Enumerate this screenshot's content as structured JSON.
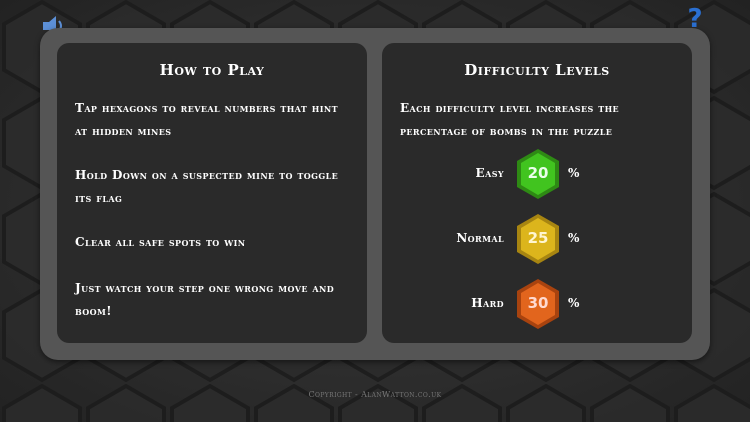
{
  "how_to_play": {
    "title": "How to Play",
    "lines": [
      "Tap hexagons to reveal numbers that hint at hidden mines",
      "Hold Down on a suspected mine to toggle its flag",
      "Clear all safe spots to win",
      "Just watch your step one wrong move and boom!"
    ]
  },
  "difficulty": {
    "title": "Difficulty Levels",
    "description": "Each difficulty level increases the percentage of bombs in the puzzle",
    "levels": [
      {
        "label": "Easy",
        "value": "20",
        "unit": "%",
        "color": "#3fbf1e",
        "text_color": "#eaffea"
      },
      {
        "label": "Normal",
        "value": "25",
        "unit": "%",
        "color": "#d9b41a",
        "text_color": "#fff6d0"
      },
      {
        "label": "Hard",
        "value": "30",
        "unit": "%",
        "color": "#e0631c",
        "text_color": "#ffd9d0"
      }
    ]
  },
  "footer": {
    "copyright": "Copyright - AlanWatton.co.uk"
  },
  "icons": {
    "sound": "speaker-icon",
    "help": "question-icon"
  }
}
